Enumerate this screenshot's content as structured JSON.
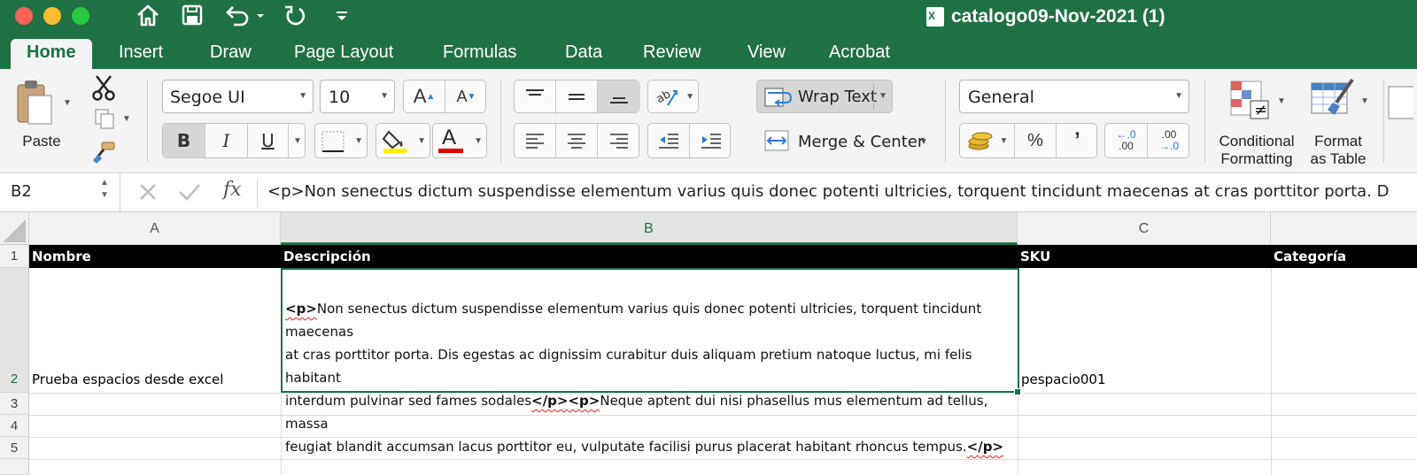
{
  "window": {
    "title": "catalogo09-Nov-2021 (1)",
    "quick_access": [
      "home-icon",
      "save-icon",
      "undo-icon",
      "redo-icon",
      "customize-icon"
    ]
  },
  "tabs": [
    "Home",
    "Insert",
    "Draw",
    "Page Layout",
    "Formulas",
    "Data",
    "Review",
    "View",
    "Acrobat"
  ],
  "active_tab": "Home",
  "ribbon": {
    "paste_label": "Paste",
    "font_name": "Segoe UI",
    "font_size": "10",
    "increase_font": "A",
    "decrease_font": "A",
    "bold": "B",
    "italic": "I",
    "underline": "U",
    "font_color_letter": "A",
    "highlight_color": "#ffee00",
    "font_color": "#e00000",
    "wrap_text": "Wrap Text",
    "merge_center": "Merge & Center",
    "number_format": "General",
    "percent": "%",
    "comma": "ʼ",
    "inc_decimal_top": "←.0",
    "inc_decimal_bottom": ".00",
    "dec_decimal_top": ".00",
    "dec_decimal_bottom": "→.0",
    "conditional_formatting_1": "Conditional",
    "conditional_formatting_2": "Formatting",
    "format_as_table_1": "Format",
    "format_as_table_2": "as Table"
  },
  "formula_bar": {
    "name_box": "B2",
    "fx": "fx",
    "formula": "<p>Non senectus dictum suspendisse elementum varius quis donec potenti ultricies, torquent tincidunt maecenas at cras porttitor porta. D"
  },
  "columns": [
    "A",
    "B",
    "C"
  ],
  "rows": [
    "1",
    "2",
    "3",
    "4",
    "5"
  ],
  "cells": {
    "A1": "Nombre",
    "B1": "Descripción",
    "C1": "SKU",
    "D1": "Categoría",
    "A2": "Prueba espacios desde excel",
    "C2": "pespacio001",
    "B2_parts": {
      "tag1": "<p>",
      "text1_line1": "Non senectus dictum suspendisse elementum varius quis donec potenti ultricies, torquent tincidunt maecenas",
      "text1_line2": "at cras porttitor porta. Dis egestas ac dignissim curabitur duis aliquam pretium natoque luctus, mi felis habitant",
      "text1_line3": "interdum pulvinar sed fames sodales",
      "tag2": "</p>",
      "tag3": "<p>",
      "text2_line3": "Neque aptent dui nisi phasellus mus elementum ad tellus, massa",
      "text2_line4": "feugiat blandit accumsan lacus porttitor eu, vulputate facilisi purus placerat habitant rhoncus tempus.",
      "tag4": "</p>"
    }
  },
  "selected_cell": "B2",
  "colors": {
    "excel_green": "#1e7145",
    "header_row_bg": "#000000"
  }
}
